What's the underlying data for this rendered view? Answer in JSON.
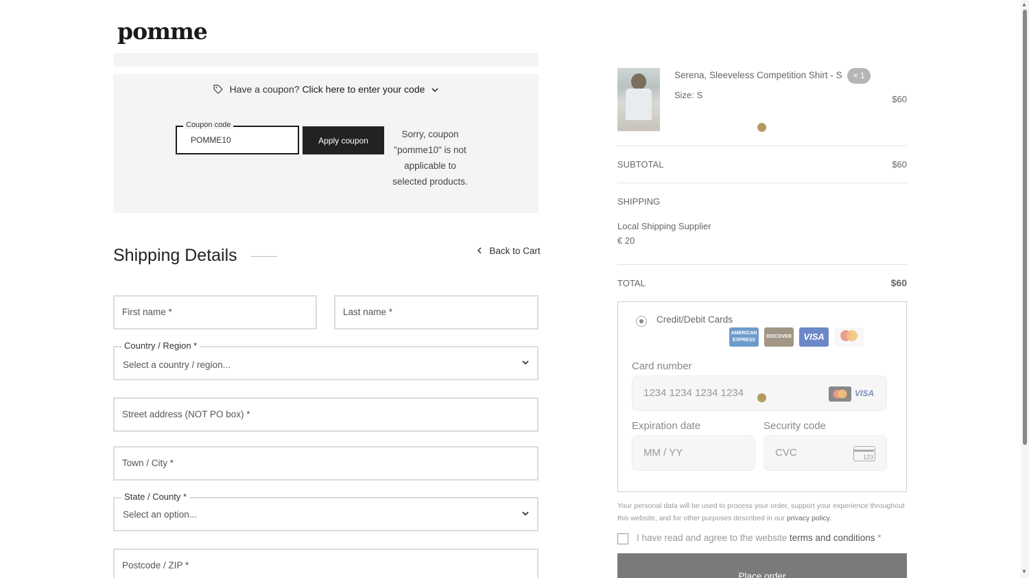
{
  "brand": {
    "logo": "pomme"
  },
  "coupon": {
    "prompt": "Have a coupon?",
    "link": "Click here to enter your code",
    "field_label": "Coupon code",
    "field_value": "POMME10",
    "apply_label": "Apply coupon",
    "error_message": "Sorry, coupon \"pomme10\" is not applicable to selected products."
  },
  "shipping": {
    "title": "Shipping Details",
    "back_link": "Back to Cart",
    "first_name_placeholder": "First name *",
    "last_name_placeholder": "Last name *",
    "country_label": "Country / Region *",
    "country_value": "Select a country / region...",
    "street_placeholder": "Street address (NOT PO box) *",
    "town_placeholder": "Town / City *",
    "state_label": "State / County *",
    "state_value": "Select an option...",
    "postcode_placeholder": "Postcode / ZIP *"
  },
  "order": {
    "product_name": "Serena, Sleeveless Competition Shirt - S",
    "quantity": "× 1",
    "size": "Size: S",
    "price": "$60",
    "subtotal_label": "SUBTOTAL",
    "subtotal_value": "$60",
    "shipping_label": "SHIPPING",
    "shipping_method": "Local Shipping Supplier",
    "shipping_cost": "€ 20",
    "total_label": "TOTAL",
    "total_value": "$60"
  },
  "payment": {
    "method_label": "Credit/Debit Cards",
    "card_logos": [
      "AMERICAN EXPRESS",
      "DISCOVER",
      "VISA",
      "mastercard"
    ],
    "card_number_label": "Card number",
    "card_number_placeholder": "1234 1234 1234 1234",
    "expiry_label": "Expiration date",
    "expiry_placeholder": "MM / YY",
    "cvc_label": "Security code",
    "cvc_placeholder": "CVC",
    "cvc_icon_text": "123",
    "visa_small": "VISA"
  },
  "legal": {
    "privacy_text": "Your personal data will be used to process your order, support your experience throughout this website, and for other purposes described in our",
    "privacy_link": "privacy policy.",
    "agree_text": "I have read and agree to the website",
    "terms_link": "terms and conditions",
    "required_mark": "*"
  },
  "place_order_label": "Place order",
  "colors": {
    "dark_button": "#222222",
    "place_order_button": "#7a7a7a",
    "panel_bg": "#f4f4f4",
    "accent_dot": "#b59a5e"
  },
  "icons": [
    "tag-icon",
    "chevron-down-icon",
    "chevron-left-icon",
    "radio-icon",
    "credit-card-icon"
  ]
}
